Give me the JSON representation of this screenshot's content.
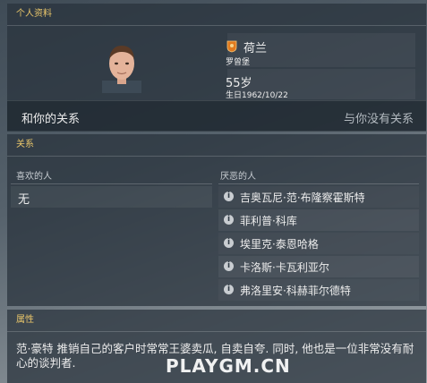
{
  "profile": {
    "section_title": "个人资料",
    "nationality": "荷兰",
    "club": "罗曾堡",
    "age": "55岁",
    "birth_date": "生日1962/10/22",
    "relationship_label": "和你的关系",
    "relationship_value": "与你没有关系"
  },
  "relations": {
    "section_title": "关系",
    "liked_header": "喜欢的人",
    "disliked_header": "厌恶的人",
    "liked": [
      "无"
    ],
    "disliked": [
      "吉奥瓦尼·范·布隆察霍斯特",
      "菲利普·科库",
      "埃里克·泰恩哈格",
      "卡洛斯·卡瓦利亚尔",
      "弗洛里安·科赫菲尔德特"
    ]
  },
  "attributes": {
    "section_title": "属性",
    "description": "范·豪特 推销自己的客户时常常王婆卖瓜, 自卖自夸. 同时, 他也是一位非常没有耐心的谈判者."
  },
  "watermark": "PLAYGM.CN",
  "icons": {
    "info": "i",
    "flag": "orange-lion-crest"
  },
  "colors": {
    "accent": "#e9c66a"
  }
}
